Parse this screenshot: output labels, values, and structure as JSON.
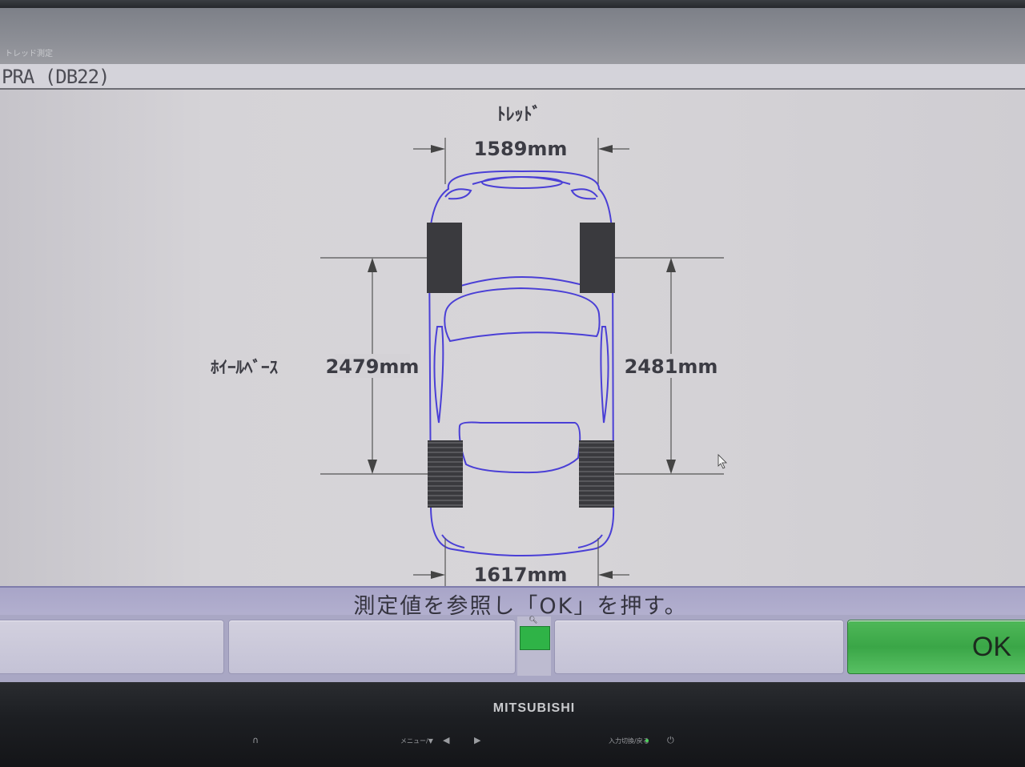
{
  "window": {
    "caption": "トレッド測定",
    "title": "PRA (DB22)"
  },
  "diagram": {
    "tread_heading": "ﾄﾚｯﾄﾞ",
    "front_tread": "1589mm",
    "rear_tread": "1617mm",
    "wheelbase_label": "ﾎｲｰﾙﾍﾞｰｽ",
    "wheelbase_left": "2479mm",
    "wheelbase_right": "2481mm",
    "car_outline_color": "#4a3fd6",
    "tire_color": "#3a3a3e"
  },
  "message": "測定値を参照し「OK」を押す。",
  "buttons": {
    "ok_label": "OK",
    "indicator_color": "#2fb347"
  },
  "monitor": {
    "brand": "MITSUBISHI",
    "menu_label": "メニュー/▼",
    "input_label": "入力切換/戻る"
  }
}
